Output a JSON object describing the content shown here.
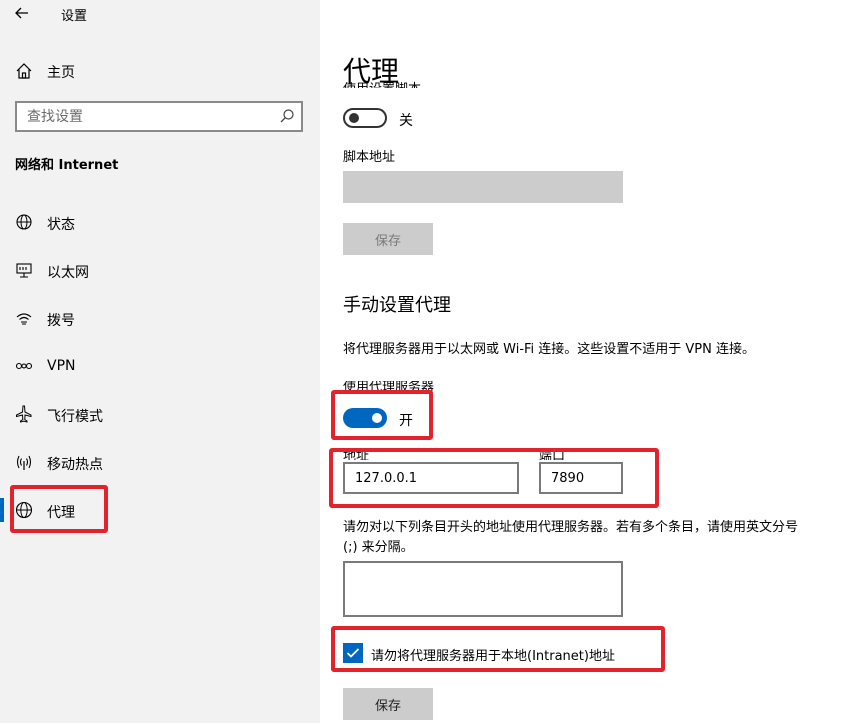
{
  "window": {
    "title": "设置"
  },
  "sidebar": {
    "home_label": "主页",
    "search_placeholder": "查找设置",
    "section_title": "网络和 Internet",
    "items": [
      {
        "label": "状态",
        "icon": "globe-status-icon"
      },
      {
        "label": "以太网",
        "icon": "ethernet-icon"
      },
      {
        "label": "拨号",
        "icon": "dialup-icon"
      },
      {
        "label": "VPN",
        "icon": "vpn-icon"
      },
      {
        "label": "飞行模式",
        "icon": "airplane-icon"
      },
      {
        "label": "移动热点",
        "icon": "hotspot-icon"
      },
      {
        "label": "代理",
        "icon": "globe-icon",
        "active": true
      }
    ]
  },
  "main": {
    "page_title": "代理",
    "auto": {
      "toggle_label_cut": "使用设置脚本",
      "toggle_state_text": "关",
      "script_address_label": "脚本地址",
      "script_address_value": "",
      "save_label": "保存"
    },
    "manual": {
      "heading": "手动设置代理",
      "description": "将代理服务器用于以太网或 Wi-Fi 连接。这些设置不适用于 VPN 连接。",
      "use_proxy_label": "使用代理服务器",
      "use_proxy_state_text": "开",
      "address_label": "地址",
      "address_value": "127.0.0.1",
      "port_label": "端口",
      "port_value": "7890",
      "exceptions_description": "请勿对以下列条目开头的地址使用代理服务器。若有多个条目，请使用英文分号 (;) 来分隔。",
      "exceptions_value": "",
      "bypass_local_label": "请勿将代理服务器用于本地(Intranet)地址",
      "bypass_local_checked": true,
      "save_label": "保存"
    }
  },
  "colors": {
    "accent": "#0067c0",
    "highlight": "#e3232b",
    "sidebar_bg": "#f2f2f2",
    "disabled": "#cccccc"
  }
}
